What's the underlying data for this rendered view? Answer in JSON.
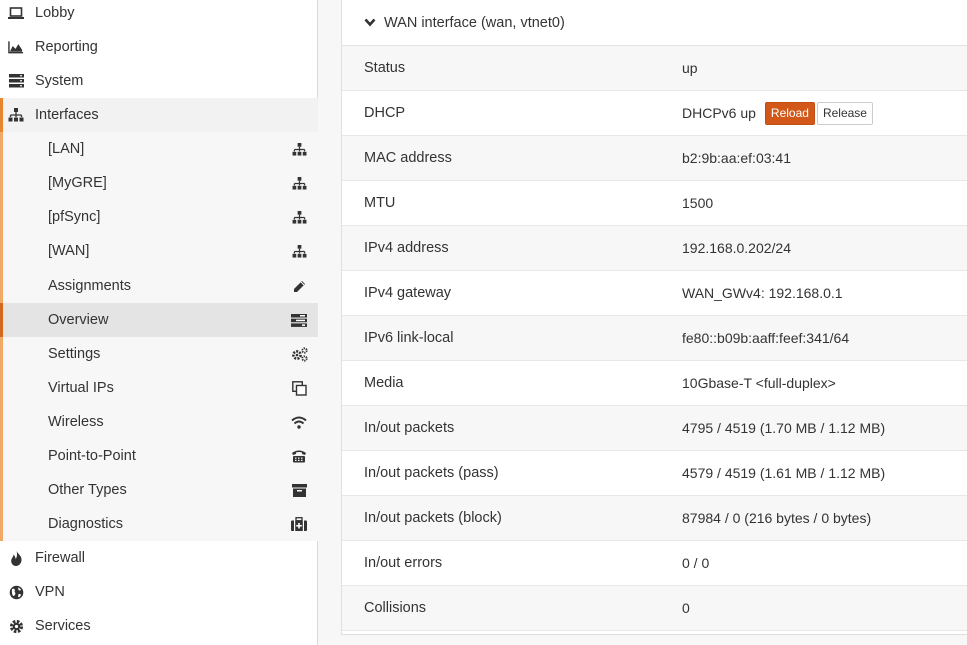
{
  "sidebar": {
    "top_items": [
      {
        "label": "Lobby",
        "icon": "laptop-icon"
      },
      {
        "label": "Reporting",
        "icon": "area-chart-icon"
      },
      {
        "label": "System",
        "icon": "server-icon"
      },
      {
        "label": "Interfaces",
        "icon": "sitemap-icon"
      }
    ],
    "interfaces_sub": [
      {
        "label": "[LAN]",
        "icon": "sitemap-icon"
      },
      {
        "label": "[MyGRE]",
        "icon": "sitemap-icon"
      },
      {
        "label": "[pfSync]",
        "icon": "sitemap-icon"
      },
      {
        "label": "[WAN]",
        "icon": "sitemap-icon"
      },
      {
        "label": "Assignments",
        "icon": "pencil-icon"
      },
      {
        "label": "Overview",
        "icon": "tasks-icon"
      },
      {
        "label": "Settings",
        "icon": "gears-icon"
      },
      {
        "label": "Virtual IPs",
        "icon": "clone-icon"
      },
      {
        "label": "Wireless",
        "icon": "wifi-icon"
      },
      {
        "label": "Point-to-Point",
        "icon": "fax-icon"
      },
      {
        "label": "Other Types",
        "icon": "archive-icon"
      },
      {
        "label": "Diagnostics",
        "icon": "medkit-icon"
      }
    ],
    "bottom_items": [
      {
        "label": "Firewall",
        "icon": "fire-icon"
      },
      {
        "label": "VPN",
        "icon": "globe-icon"
      },
      {
        "label": "Services",
        "icon": "cog-icon"
      }
    ],
    "selected": "Overview"
  },
  "panel": {
    "title": "WAN interface (wan, vtnet0)",
    "rows": [
      {
        "key": "Status",
        "value": "up"
      },
      {
        "key": "DHCP",
        "value": "DHCPv6 up"
      },
      {
        "key": "MAC address",
        "value": "b2:9b:aa:ef:03:41"
      },
      {
        "key": "MTU",
        "value": "1500"
      },
      {
        "key": "IPv4 address",
        "value": "192.168.0.202/24"
      },
      {
        "key": "IPv4 gateway",
        "value": "WAN_GWv4: 192.168.0.1"
      },
      {
        "key": "IPv6 link-local",
        "value": "fe80::b09b:aaff:feef:341/64"
      },
      {
        "key": "Media",
        "value": "10Gbase-T <full-duplex>"
      },
      {
        "key": "In/out packets",
        "value": "4795 / 4519 (1.70 MB / 1.12 MB)"
      },
      {
        "key": "In/out packets (pass)",
        "value": "4579 / 4519 (1.61 MB / 1.12 MB)"
      },
      {
        "key": "In/out packets (block)",
        "value": "87984 / 0 (216 bytes / 0 bytes)"
      },
      {
        "key": "In/out errors",
        "value": "0 / 0"
      },
      {
        "key": "Collisions",
        "value": "0"
      }
    ],
    "dhcp_buttons": {
      "reload": "Reload",
      "release": "Release"
    }
  },
  "colors": {
    "accent": "#d2581a",
    "sidebar_marker": "#f2a867"
  }
}
